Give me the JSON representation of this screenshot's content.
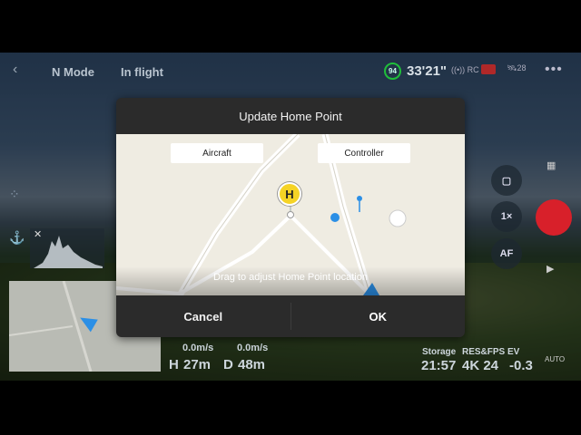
{
  "topbar": {
    "mode": "N Mode",
    "status": "In flight",
    "battery_percent": "94",
    "flight_time": "33'21\"",
    "signal_label": "((•)) RC",
    "satellite_count": "28"
  },
  "telemetry": {
    "h_speed": "0.0m/s",
    "v_speed": "0.0m/s",
    "height_label": "H",
    "height_value": "27m",
    "distance_label": "D",
    "distance_value": "48m",
    "storage_label": "Storage",
    "storage_value": "21:57",
    "res_label": "RES&FPS",
    "res_value": "4K 24",
    "ev_label": "EV",
    "ev_value": "-0.3"
  },
  "controls": {
    "zoom_label": "1×",
    "focus_label": "AF",
    "auto_label": "AUTO"
  },
  "dialog": {
    "title": "Update Home Point",
    "aircraft_label": "Aircraft",
    "controller_label": "Controller",
    "home_marker": "H",
    "hint": "Drag to adjust Home Point location",
    "cancel_label": "Cancel",
    "ok_label": "OK"
  },
  "colors": {
    "battery_ring": "#1fbf3a",
    "shutter": "#d8202a",
    "home_marker": "#f5d325",
    "aircraft_arrow": "#2b8fe6",
    "dialog_bg": "#2b2b2b",
    "map_bg": "#efece2"
  }
}
